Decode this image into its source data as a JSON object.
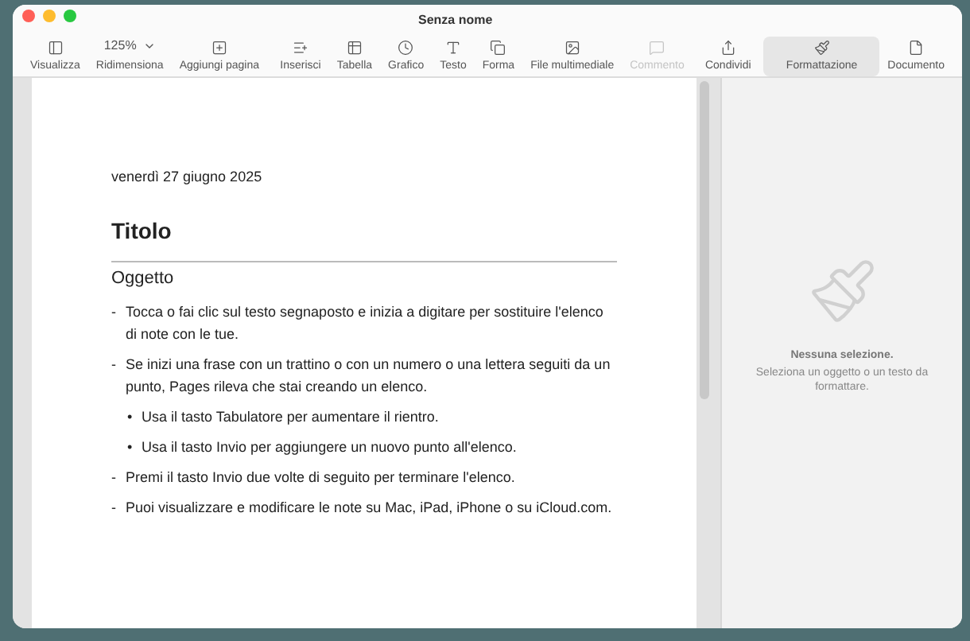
{
  "window": {
    "title": "Senza nome"
  },
  "toolbar": [
    {
      "label": "Visualizza",
      "kind": "icon",
      "disabled": false,
      "selected": false
    },
    {
      "label": "Ridimensiona",
      "kind": "zoom",
      "value": "125%",
      "disabled": false,
      "selected": false
    },
    {
      "label": "Aggiungi pagina",
      "kind": "icon",
      "disabled": false,
      "selected": false
    },
    {
      "label": "Inserisci",
      "kind": "icon",
      "disabled": false,
      "selected": false
    },
    {
      "label": "Tabella",
      "kind": "icon",
      "disabled": false,
      "selected": false
    },
    {
      "label": "Grafico",
      "kind": "icon",
      "disabled": false,
      "selected": false
    },
    {
      "label": "Testo",
      "kind": "icon",
      "disabled": false,
      "selected": false
    },
    {
      "label": "Forma",
      "kind": "icon",
      "disabled": false,
      "selected": false
    },
    {
      "label": "File multimediale",
      "kind": "icon",
      "disabled": false,
      "selected": false
    },
    {
      "label": "Commento",
      "kind": "icon",
      "disabled": true,
      "selected": false
    },
    {
      "label": "Condividi",
      "kind": "icon",
      "disabled": false,
      "selected": false
    },
    {
      "label": "Formattazione",
      "kind": "icon",
      "disabled": false,
      "selected": true
    },
    {
      "label": "Documento",
      "kind": "icon",
      "disabled": false,
      "selected": false
    }
  ],
  "document": {
    "date": "venerdì 27 giugno 2025",
    "title": "Titolo",
    "subject": "Oggetto",
    "items": [
      {
        "marker": "-",
        "text": "Tocca o fai clic sul testo segnaposto e inizia a digitare per sostituire l'elenco di note con le tue."
      },
      {
        "marker": "-",
        "text": "Se inizi una frase con un trattino o con un numero o una lettera seguiti da un punto, Pages rileva che stai creando un elenco.",
        "children": [
          {
            "marker": "•",
            "text": "Usa il tasto Tabulatore per aumentare il rientro."
          },
          {
            "marker": "•",
            "text": "Usa il tasto Invio per aggiungere un nuovo punto all'elenco."
          }
        ]
      },
      {
        "marker": "-",
        "text": "Premi il tasto Invio due volte di seguito per terminare l'elenco."
      },
      {
        "marker": "-",
        "text": "Puoi visualizzare e modificare le note su Mac, iPad, iPhone o su iCloud.com."
      }
    ]
  },
  "sidebar": {
    "heading": "Nessuna selezione.",
    "message": "Seleziona un oggetto o un testo da formattare."
  }
}
